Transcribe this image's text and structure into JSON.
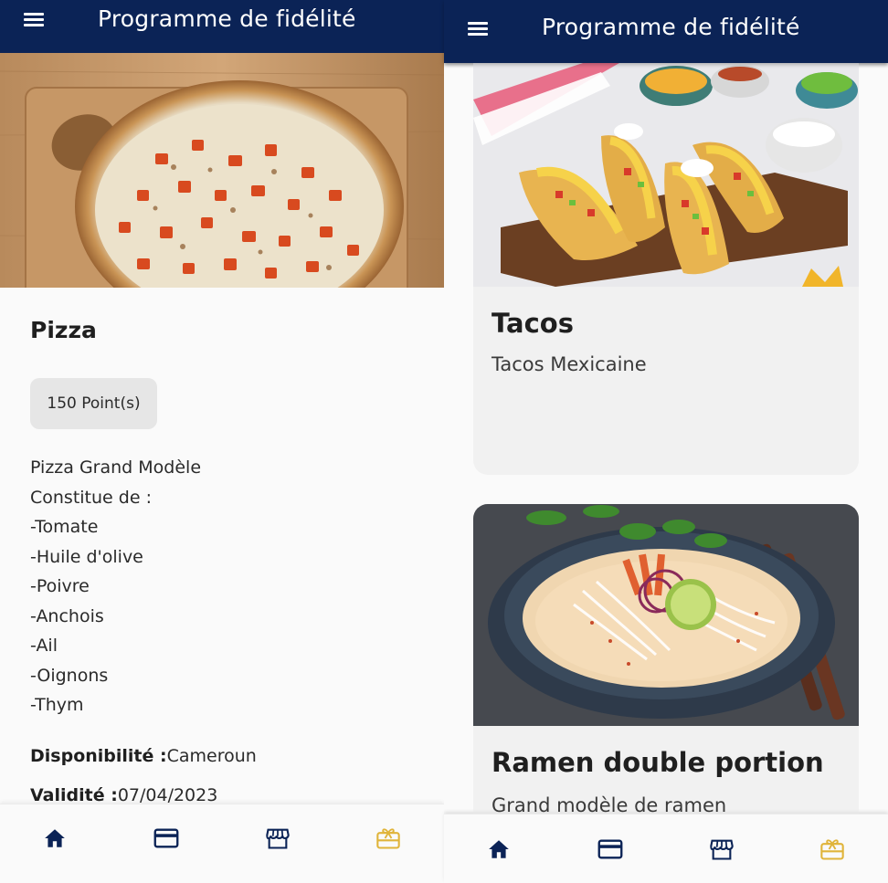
{
  "colors": {
    "appbar": "#0b2356",
    "nav_icon": "#0b2356",
    "nav_active": "#e0b43a",
    "chip_bg": "#e6e6e6"
  },
  "left": {
    "appbar": {
      "title": "Programme de fidélité",
      "menu_icon": "hamburger-menu-icon"
    },
    "reward": {
      "title": "Pizza",
      "points": "150 Point(s)",
      "description": [
        "Pizza Grand Modèle",
        "Constitue de :",
        "-Tomate",
        "-Huile d'olive",
        "-Poivre",
        "-Anchois",
        "-Ail",
        "-Oignons",
        "-Thym"
      ],
      "availability_label": "Disponibilité :",
      "availability_value": "Cameroun",
      "validity_label": "Validité :",
      "validity_value": "07/04/2023"
    },
    "nav": [
      "home-icon",
      "card-icon",
      "store-icon",
      "gift-card-icon"
    ]
  },
  "right": {
    "appbar": {
      "title": "Programme de fidélité",
      "menu_icon": "hamburger-menu-icon"
    },
    "cards": [
      {
        "title": "Tacos",
        "subtitle": "Tacos Mexicaine"
      },
      {
        "title": "Ramen double portion",
        "subtitle": "Grand modèle de ramen"
      }
    ],
    "nav": [
      "home-icon",
      "card-icon",
      "store-icon",
      "gift-card-icon"
    ],
    "active_nav": "gift-card-icon"
  }
}
